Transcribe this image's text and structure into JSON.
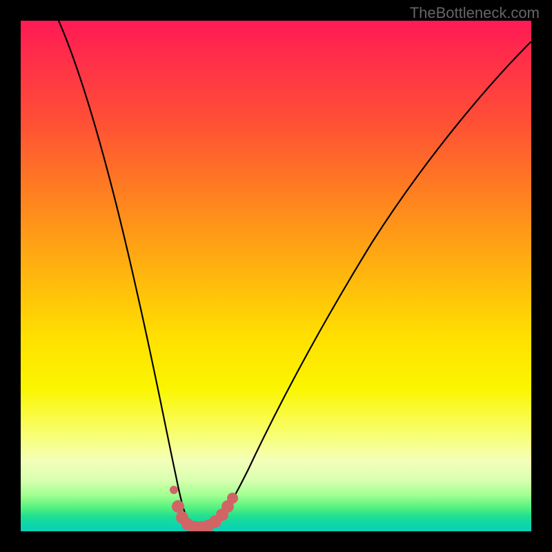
{
  "watermark": "TheBottleneck.com",
  "chart_data": {
    "type": "line",
    "title": "",
    "xlabel": "",
    "ylabel": "",
    "xlim": [
      0,
      100
    ],
    "ylim": [
      0,
      100
    ],
    "series": [
      {
        "name": "bottleneck-curve",
        "x": [
          8,
          12,
          16,
          20,
          24,
          27,
          29,
          31,
          33,
          35,
          37,
          40,
          45,
          52,
          60,
          70,
          82,
          95,
          100
        ],
        "y": [
          100,
          88,
          74,
          57,
          38,
          22,
          12,
          4,
          0,
          0,
          0,
          3,
          10,
          22,
          36,
          51,
          66,
          80,
          85
        ]
      }
    ],
    "markers": {
      "name": "highlight-segment",
      "color": "#d16565",
      "points": [
        {
          "x": 29.5,
          "y": 7
        },
        {
          "x": 30.5,
          "y": 2
        },
        {
          "x": 32,
          "y": 0.5
        },
        {
          "x": 34,
          "y": 0.5
        },
        {
          "x": 36,
          "y": 1
        },
        {
          "x": 38,
          "y": 3
        },
        {
          "x": 40,
          "y": 6
        }
      ]
    },
    "gradient_stops": [
      {
        "pct": 0,
        "color": "#ff1a55"
      },
      {
        "pct": 50,
        "color": "#ffe000"
      },
      {
        "pct": 95,
        "color": "#50f080"
      },
      {
        "pct": 100,
        "color": "#08d0b8"
      }
    ]
  }
}
